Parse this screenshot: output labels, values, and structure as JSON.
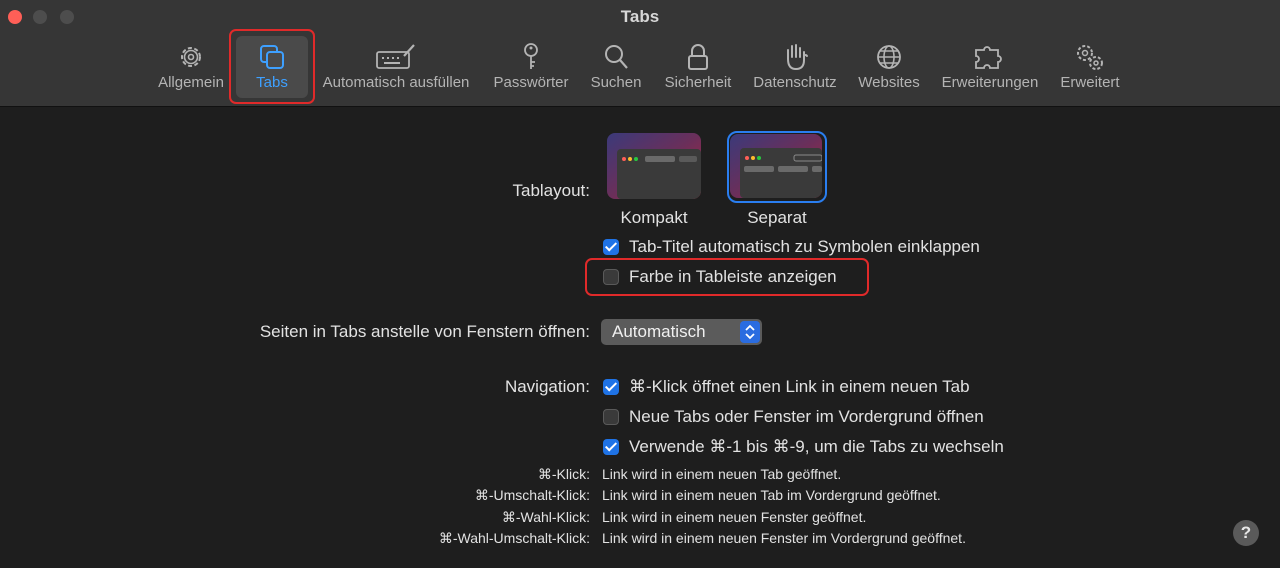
{
  "window": {
    "title": "Tabs"
  },
  "toolbar": {
    "items": [
      {
        "label": "Allgemein",
        "icon": "gear-icon"
      },
      {
        "label": "Tabs",
        "icon": "tabs-icon"
      },
      {
        "label": "Automatisch ausfüllen",
        "icon": "keyboard-pen-icon"
      },
      {
        "label": "Passwörter",
        "icon": "key-icon"
      },
      {
        "label": "Suchen",
        "icon": "magnifier-icon"
      },
      {
        "label": "Sicherheit",
        "icon": "lock-icon"
      },
      {
        "label": "Datenschutz",
        "icon": "hand-icon"
      },
      {
        "label": "Websites",
        "icon": "globe-icon"
      },
      {
        "label": "Erweiterungen",
        "icon": "puzzle-icon"
      },
      {
        "label": "Erweitert",
        "icon": "gears-icon"
      }
    ],
    "active_index": 1
  },
  "tablayout": {
    "label": "Tablayout:",
    "options": [
      {
        "label": "Kompakt",
        "selected": false
      },
      {
        "label": "Separat",
        "selected": true
      }
    ]
  },
  "tab_options": [
    {
      "label": "Tab-Titel automatisch zu Symbolen einklappen",
      "checked": true
    },
    {
      "label": "Farbe in Tableiste anzeigen",
      "checked": false
    }
  ],
  "open_pages": {
    "label": "Seiten in Tabs anstelle von Fenstern öffnen:",
    "value": "Automatisch"
  },
  "navigation": {
    "label": "Navigation:",
    "options": [
      {
        "label": "⌘-Klick öffnet einen Link in einem neuen Tab",
        "checked": true
      },
      {
        "label": "Neue Tabs oder Fenster im Vordergrund öffnen",
        "checked": false
      },
      {
        "label": "Verwende ⌘-1 bis ⌘-9, um die Tabs zu wechseln",
        "checked": true
      }
    ]
  },
  "shortcuts": [
    {
      "key": "⌘-Klick:",
      "desc": "Link wird in einem neuen Tab geöffnet."
    },
    {
      "key": "⌘-Umschalt-Klick:",
      "desc": "Link wird in einem neuen Tab im Vordergrund geöffnet."
    },
    {
      "key": "⌘-Wahl-Klick:",
      "desc": "Link wird in einem neuen Fenster geöffnet."
    },
    {
      "key": "⌘-Wahl-Umschalt-Klick:",
      "desc": "Link wird in einem neuen Fenster im Vordergrund geöffnet."
    }
  ],
  "help": {
    "label": "?"
  },
  "colors": {
    "accent": "#1f73e6",
    "highlight": "#e02a2a",
    "active_label": "#3ea0ff"
  }
}
